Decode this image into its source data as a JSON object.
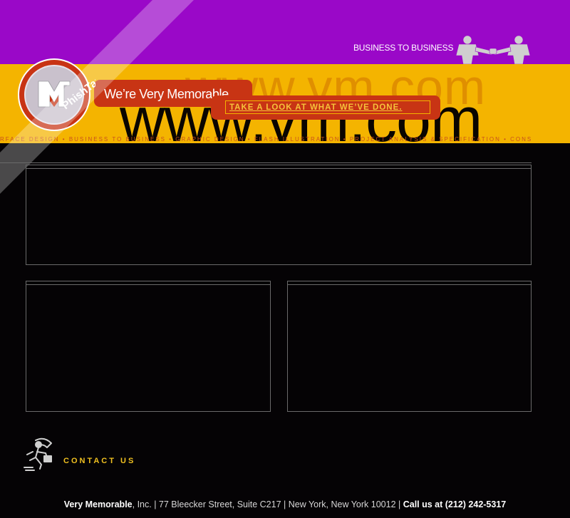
{
  "header": {
    "b2b_label": "BUSINESS TO BUSINESS",
    "ghost_url": "www.vm.com",
    "big_url": "www.vm.com",
    "ticker": "RFACE DESIGN • BUSINESS TO BUSINESS • GRAPHIC DESIGN • FLASH ILLUSTRATION • PROJECT ANALYSIS & SPECIFICATION • CONS",
    "tagline": "We’re Very Memorable.",
    "cta": "TAKE A LOOK AT WHAT WE’VE DONE."
  },
  "logo": {
    "watermark": "PhishTank",
    "icon": "vm-logo-icon"
  },
  "contact": {
    "label": "CONTACT US",
    "icon": "messenger-runner-icon"
  },
  "footer": {
    "company": "Very Memorable",
    "company_suffix": ", Inc. | 77 Bleecker Street, Suite C217 | New York, New York 10012 | ",
    "call": "Call us at (212) 242-5317"
  },
  "colors": {
    "purple": "#9a08c8",
    "gold": "#f4b400",
    "red": "#c83414",
    "background": "#050305"
  }
}
